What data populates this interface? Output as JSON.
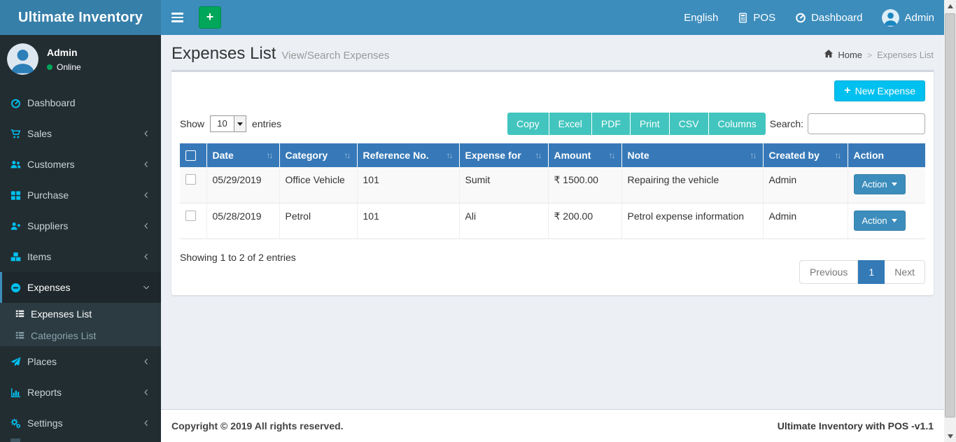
{
  "brand": {
    "title": "Ultimate Inventory"
  },
  "topbar": {
    "language": "English",
    "pos_label": "POS",
    "dashboard_label": "Dashboard",
    "user_label": "Admin"
  },
  "sidebar": {
    "user": {
      "name": "Admin",
      "status": "Online"
    },
    "items": [
      {
        "label": "Dashboard",
        "icon": "gauge-icon"
      },
      {
        "label": "Sales",
        "icon": "cart-icon"
      },
      {
        "label": "Customers",
        "icon": "users-icon"
      },
      {
        "label": "Purchase",
        "icon": "grid-icon"
      },
      {
        "label": "Suppliers",
        "icon": "user-plus-icon"
      },
      {
        "label": "Items",
        "icon": "cubes-icon"
      },
      {
        "label": "Expenses",
        "icon": "minus-circle-icon",
        "active": true,
        "children": [
          {
            "label": "Expenses List",
            "icon": "list-icon",
            "active": true
          },
          {
            "label": "Categories List",
            "icon": "list-icon"
          }
        ]
      },
      {
        "label": "Places",
        "icon": "paper-plane-icon"
      },
      {
        "label": "Reports",
        "icon": "bar-chart-icon"
      },
      {
        "label": "Settings",
        "icon": "gears-icon"
      }
    ]
  },
  "page": {
    "title": "Expenses List",
    "subtitle": "View/Search Expenses",
    "breadcrumb": {
      "home": "Home",
      "separator": ">",
      "current": "Expenses List"
    }
  },
  "toolbar": {
    "new_expense_label": "New Expense",
    "show_label": "Show",
    "entries_value": "10",
    "entries_label": "entries",
    "export_buttons": [
      "Copy",
      "Excel",
      "PDF",
      "Print",
      "CSV",
      "Columns"
    ],
    "search_label": "Search:",
    "search_value": ""
  },
  "table": {
    "columns": [
      "Date",
      "Category",
      "Reference No.",
      "Expense for",
      "Amount",
      "Note",
      "Created by",
      "Action"
    ],
    "rows": [
      {
        "date": "05/29/2019",
        "category": "Office Vehicle",
        "reference": "101",
        "expense_for": "Sumit",
        "amount": "₹ 1500.00",
        "note": "Repairing the vehicle",
        "created_by": "Admin",
        "action": "Action"
      },
      {
        "date": "05/28/2019",
        "category": "Petrol",
        "reference": "101",
        "expense_for": "Ali",
        "amount": "₹ 200.00",
        "note": "Petrol expense information",
        "created_by": "Admin",
        "action": "Action"
      }
    ],
    "summary": "Showing 1 to 2 of 2 entries",
    "pagination": {
      "previous": "Previous",
      "current": "1",
      "next": "Next"
    }
  },
  "footer": {
    "left": "Copyright © 2019 All rights reserved.",
    "right": "Ultimate Inventory with POS -v1.1"
  },
  "icons": {
    "hamburger-icon": "≡",
    "plus-icon": "+",
    "sort-icon": "↑↓",
    "caret-down-icon": "▾",
    "online-dot-icon": "●",
    "calculator-icon": "svg-calculator",
    "gauge-icon": "svg-gauge",
    "home-icon": "svg-house",
    "avatar-icon": "svg-person-circle"
  },
  "colors": {
    "navbar": "#3c8dbc",
    "logo_bg": "#367fa9",
    "sidebar_bg": "#222d32",
    "submenu_bg": "#2c3b41",
    "icon_cyan": "#00c0ef",
    "green": "#00a65a",
    "info_blue": "#00c0ef",
    "table_header": "#3779b8",
    "teal_button": "#42c5be",
    "pagination_active": "#337ab7",
    "content_bg": "#ecf0f5"
  }
}
